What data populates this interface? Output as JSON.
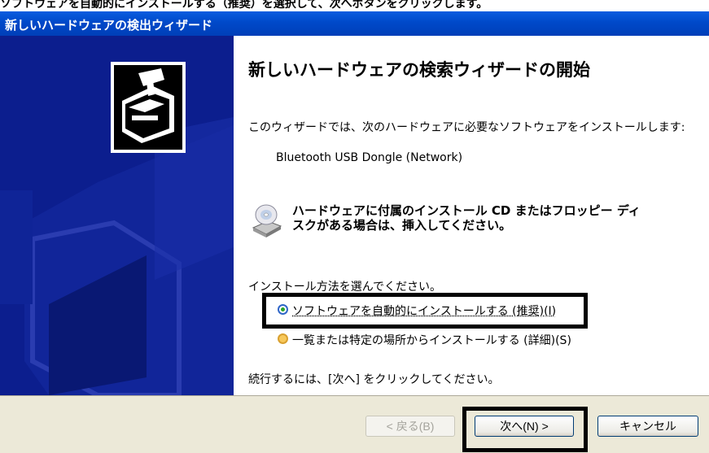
{
  "top_strip_text": "ソフトウェアを自動的にインストールする（推奨）を選択して、次へボタンをクリックします。",
  "window": {
    "title": "新しいハードウェアの検出ウィザード"
  },
  "wizard": {
    "heading": "新しいハードウェアの検索ウィザードの開始",
    "intro": "このウィザードでは、次のハードウェアに必要なソフトウェアをインストールします:",
    "device_name": "Bluetooth USB Dongle (Network)",
    "cd_notice_line1": "ハードウェアに付属のインストール CD またはフロッピー ディ",
    "cd_notice_line2": "スクがある場合は、挿入してください。",
    "choose_label": "インストール方法を選んでください。",
    "option_auto": "ソフトウェアを自動的にインストールする (推奨)(I)",
    "option_manual": "一覧または特定の場所からインストールする (詳細)(S)",
    "continue_text": "続行するには、[次へ] をクリックしてください。"
  },
  "buttons": {
    "back": "< 戻る(B)",
    "next": "次へ(N) >",
    "cancel": "キャンセル"
  }
}
